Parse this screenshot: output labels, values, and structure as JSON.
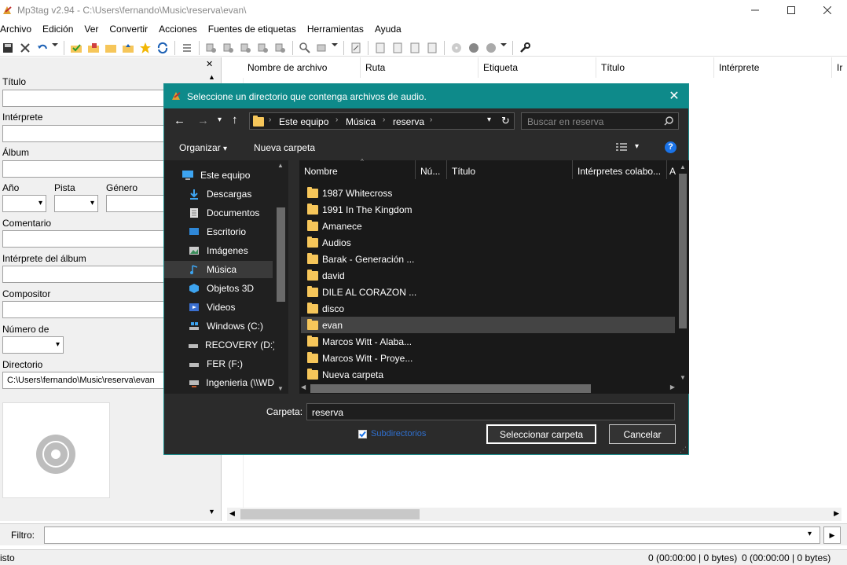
{
  "window": {
    "title": "Mp3tag v2.94  -  C:\\Users\\fernando\\Music\\reserva\\evan\\"
  },
  "menu": [
    "Archivo",
    "Edición",
    "Ver",
    "Convertir",
    "Acciones",
    "Fuentes de etiquetas",
    "Herramientas",
    "Ayuda"
  ],
  "tagpanel": {
    "titulo": "Título",
    "interprete": "Intérprete",
    "album": "Álbum",
    "anio": "Año",
    "pista": "Pista",
    "genero": "Género",
    "comentario": "Comentario",
    "interprete_album": "Intérprete del álbum",
    "compositor": "Compositor",
    "numero_de": "Número de",
    "directorio": "Directorio",
    "directorio_value": "C:\\Users\\fernando\\Music\\reserva\\evan"
  },
  "filelist": {
    "columns": [
      "Nombre de archivo",
      "Ruta",
      "Etiqueta",
      "Título",
      "Intérprete",
      "Ir"
    ]
  },
  "filter": {
    "label": "Filtro:",
    "value": ""
  },
  "status": {
    "left": "isto",
    "seg1": "0 (00:00:00 | 0 bytes)",
    "seg2": "0 (00:00:00 | 0 bytes)"
  },
  "dialog": {
    "title": "Seleccione un directorio que contenga archivos de audio.",
    "breadcrumb": [
      "Este equipo",
      "Música",
      "reserva"
    ],
    "search_placeholder": "Buscar en reserva",
    "organize": "Organizar",
    "new_folder": "Nueva carpeta",
    "nav": [
      {
        "label": "Este equipo",
        "icon": "computer-icon"
      },
      {
        "label": "Descargas",
        "icon": "download-icon"
      },
      {
        "label": "Documentos",
        "icon": "document-icon"
      },
      {
        "label": "Escritorio",
        "icon": "desktop-icon"
      },
      {
        "label": "Imágenes",
        "icon": "pictures-icon"
      },
      {
        "label": "Música",
        "icon": "music-icon"
      },
      {
        "label": "Objetos 3D",
        "icon": "cube-icon"
      },
      {
        "label": "Videos",
        "icon": "video-icon"
      },
      {
        "label": "Windows (C:)",
        "icon": "windows-drive-icon"
      },
      {
        "label": "RECOVERY (D:)",
        "icon": "drive-icon"
      },
      {
        "label": "FER (F:)",
        "icon": "drive-icon"
      },
      {
        "label": "Ingenieria (\\\\WD",
        "icon": "network-drive-icon"
      }
    ],
    "columns": [
      "Nombre",
      "Nú...",
      "Título",
      "Intérpretes colabo...",
      "A"
    ],
    "folders": [
      "1987 Whitecross",
      "1991 In The Kingdom",
      "Amanece",
      "Audios",
      "Barak - Generación ...",
      "david",
      "DILE AL CORAZON ...",
      "disco",
      "evan",
      "Marcos Witt - Alaba...",
      "Marcos Witt - Proye...",
      "Nueva carpeta"
    ],
    "selected_folder": "evan",
    "folder_label": "Carpeta:",
    "folder_value": "reserva",
    "subdirs_label": "Subdirectorios",
    "select_button": "Seleccionar carpeta",
    "cancel_button": "Cancelar"
  }
}
